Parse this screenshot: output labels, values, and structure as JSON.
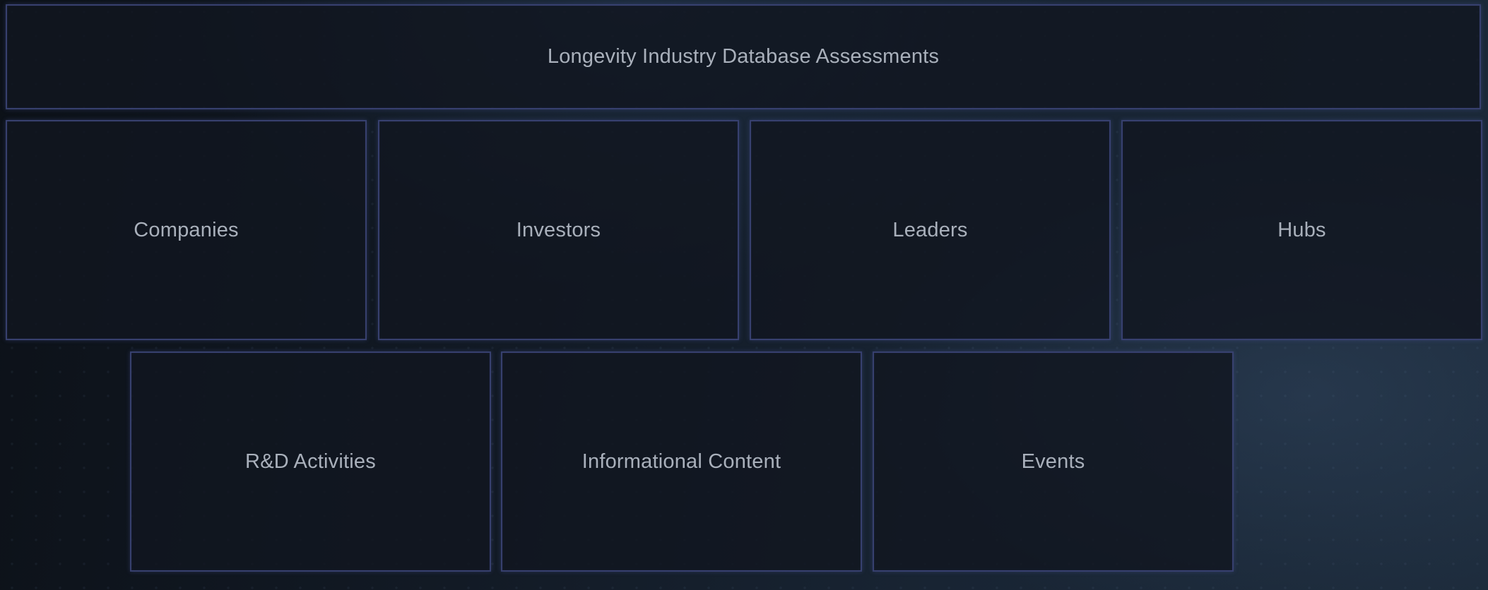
{
  "header": {
    "title": "Longevity Industry Database Assessments"
  },
  "categories": [
    {
      "label": "Companies"
    },
    {
      "label": "Investors"
    },
    {
      "label": "Leaders"
    },
    {
      "label": "Hubs"
    },
    {
      "label": "R&D Activities"
    },
    {
      "label": "Informational Content"
    },
    {
      "label": "Events"
    }
  ],
  "colors": {
    "background": "#141c27",
    "tile_background": "#111620",
    "tile_border": "#3e487d",
    "text": "#a9b0bb"
  }
}
